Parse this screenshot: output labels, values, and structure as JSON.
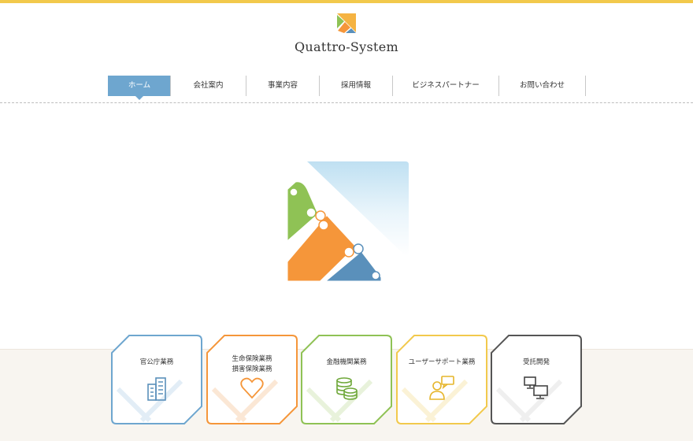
{
  "site": {
    "logo_text": "Quattro-System",
    "accent": "#f2c94c"
  },
  "nav": {
    "items": [
      {
        "label": "ホーム",
        "active": true
      },
      {
        "label": "会社案内",
        "active": false
      },
      {
        "label": "事業内容",
        "active": false
      },
      {
        "label": "採用情報",
        "active": false
      },
      {
        "label": "ビジネスパートナー",
        "active": false
      },
      {
        "label": "お問い合わせ",
        "active": false
      }
    ],
    "active_color": "#6ea6cf"
  },
  "hero": {
    "colors": {
      "green": "#8fc255",
      "orange": "#f5963a",
      "blue": "#5a90bb"
    }
  },
  "services": [
    {
      "label_line1": "官公庁業務",
      "label_line2": "",
      "icon": "building-icon",
      "color": "#6ea6cf"
    },
    {
      "label_line1": "生命保険業務",
      "label_line2": "損害保険業務",
      "icon": "heart-icon",
      "color": "#f5963a"
    },
    {
      "label_line1": "金融機関業務",
      "label_line2": "",
      "icon": "coins-icon",
      "color": "#8fc255"
    },
    {
      "label_line1": "ユーザーサポート業務",
      "label_line2": "",
      "icon": "support-chat-icon",
      "color": "#f2c94c"
    },
    {
      "label_line1": "受託開発",
      "label_line2": "",
      "icon": "computers-icon",
      "color": "#555555"
    }
  ]
}
